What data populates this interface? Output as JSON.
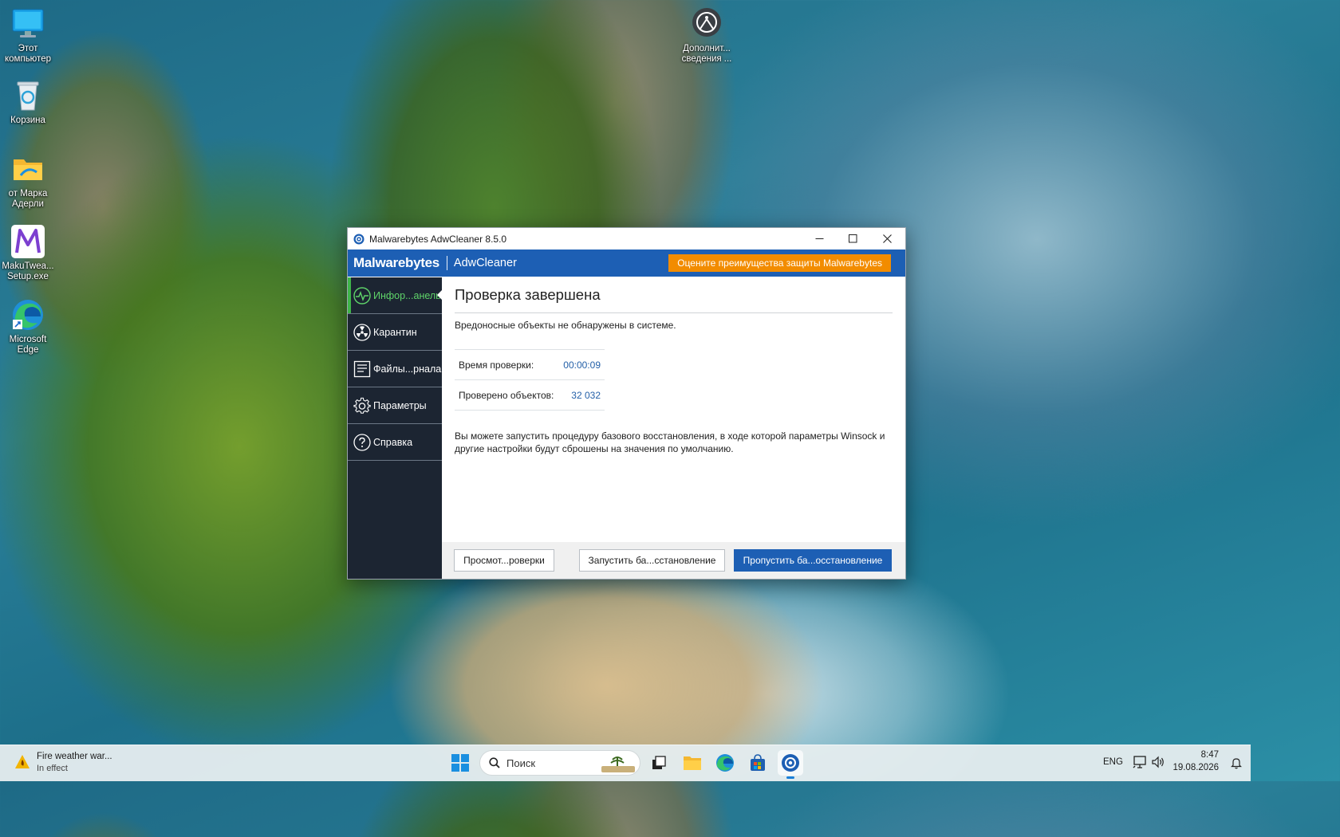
{
  "desktop": {
    "icons": [
      {
        "label": "Этот компьютер"
      },
      {
        "label": "Корзина"
      },
      {
        "label": "от Марка Адерли"
      },
      {
        "label": "MakuTwea... Setup.exe"
      },
      {
        "label": "Microsoft Edge"
      },
      {
        "label": "Дополнит... сведения ..."
      }
    ]
  },
  "window": {
    "title": "Malwarebytes AdwCleaner 8.5.0",
    "brand_logo": "Malwarebytes",
    "brand_product": "AdwCleaner",
    "promo_button": "Оцените преимущества защиты Malwarebytes",
    "sidebar": [
      {
        "label": "Инфор...анель",
        "icon": "dashboard-pulse-icon",
        "active": true
      },
      {
        "label": "Карантин",
        "icon": "quarantine-radiation-icon",
        "active": false
      },
      {
        "label": "Файлы...рнала",
        "icon": "log-files-icon",
        "active": false
      },
      {
        "label": "Параметры",
        "icon": "gear-icon",
        "active": false
      },
      {
        "label": "Справка",
        "icon": "help-icon",
        "active": false
      }
    ],
    "main": {
      "heading": "Проверка завершена",
      "summary": "Вредоносные объекты не обнаружены в системе.",
      "stats": [
        {
          "label": "Время проверки:",
          "value": "00:00:09"
        },
        {
          "label": "Проверено объектов:",
          "value": "32 032"
        }
      ],
      "info": "Вы можете запустить процедуру базового восстановления, в ходе которой параметры Winsock и другие настройки будут сброшены на значения по умолчанию."
    },
    "footer": {
      "view_report": "Просмот...роверки",
      "run_restore": "Запустить ба...сстановление",
      "skip_restore": "Пропустить ба...осстановление"
    }
  },
  "taskbar": {
    "weather_title": "Fire weather war...",
    "weather_sub": "In effect",
    "search_placeholder": "Поиск",
    "language": "ENG",
    "time": "8:47",
    "date": "19.08.2026"
  },
  "colors": {
    "brand_blue": "#1d5fb4",
    "promo_orange": "#f28c00",
    "sidebar_dark": "#1c2532",
    "active_green": "#3fb54a"
  }
}
